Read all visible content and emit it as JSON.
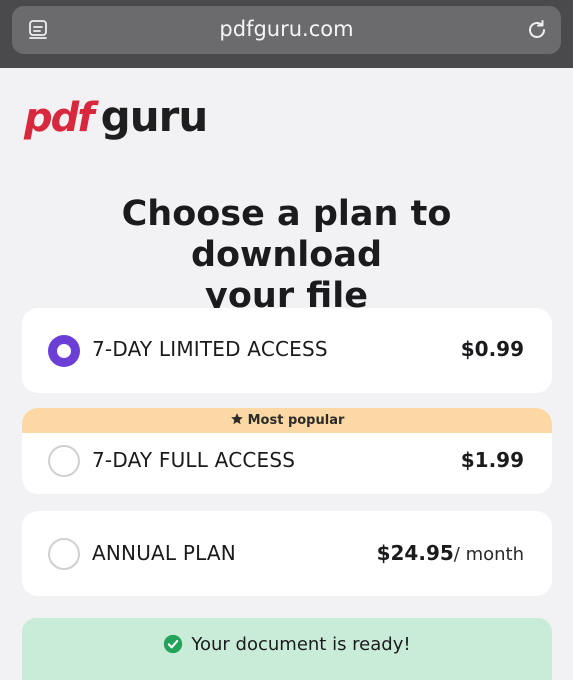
{
  "browser": {
    "url": "pdfguru.com",
    "tabs_icon": "tabs-icon",
    "reload_icon": "reload-icon"
  },
  "logo": {
    "part1": "pdf",
    "part2": "guru",
    "brand_color": "#d8283e"
  },
  "headline": {
    "line1": "Choose a plan to download",
    "line2": "your file"
  },
  "plans": [
    {
      "name": "7-DAY LIMITED ACCESS",
      "price": "$0.99",
      "period": "",
      "selected": true
    },
    {
      "name": "7-DAY FULL ACCESS",
      "price": "$1.99",
      "period": "",
      "selected": false,
      "badge": "Most popular",
      "badge_icon": "star-icon"
    },
    {
      "name": "ANNUAL PLAN",
      "price": "$24.95",
      "period": "/ month",
      "selected": false
    }
  ],
  "status": {
    "text": "Your document is ready!",
    "icon": "check-circle-icon",
    "color": "#22a35a"
  },
  "colors": {
    "accent": "#6b3fd6",
    "badge_bg": "#fcd9a4",
    "ready_bg": "#c9ecd9"
  }
}
